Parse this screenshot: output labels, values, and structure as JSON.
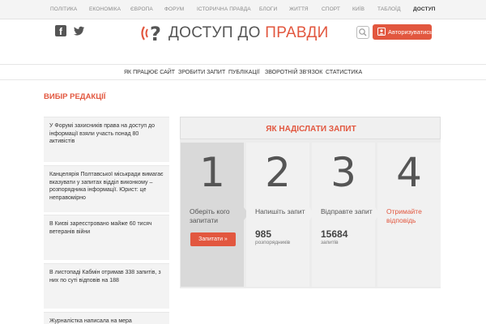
{
  "topnav": {
    "items": [
      "ПОЛІТИКА",
      "ЕКОНОМІКА",
      "ЄВРОПА",
      "ФОРУМ",
      "ІСТОРИЧНА ПРАВДА",
      "БЛОГИ",
      "ЖИТТЯ",
      "СПОРТ",
      "КИЇВ",
      "ТАБЛОЇД",
      "ДОСТУП"
    ],
    "active": "ДОСТУП"
  },
  "header": {
    "logo_text_main": "ДОСТУП ДО ",
    "logo_text_accent": "ПРАВДИ",
    "login_label": "Авторизуватись",
    "icons": [
      "facebook-icon",
      "twitter-icon",
      "search-icon",
      "user-icon"
    ]
  },
  "subnav": {
    "items": [
      "ЯК ПРАЦЮЄ САЙТ",
      "ЗРОБИТИ ЗАПИТ",
      "ПУБЛІКАЦІЇ",
      "ЗВОРОТНІЙ ЗВ'ЯЗОК",
      "СТАТИСТИКА"
    ]
  },
  "editors_choice": {
    "title": "ВИБІР РЕДАКЦІЇ",
    "items": [
      "У Форумі захисників права на доступ до інформації взяли участь понад 80 активістів",
      "Канцелярія Полтавської міськради вимагає вказувати у запитах відділ виконкому – розпорядника інформації. Юрист: це неправомірно",
      "В Києві зареєстровано майже 60 тисяч ветеранів війни",
      "В листопаді Кабмін отримав 338 запитів, з них по суті відповів на 188",
      "Журналістка написала на мера"
    ]
  },
  "howto": {
    "title": "ЯК НАДІСЛАТИ ЗАПИТ",
    "steps": [
      {
        "num": "1",
        "text": "Оберіть кого запитати",
        "button": "Запитати »"
      },
      {
        "num": "2",
        "text": "Напишіть запит",
        "count": "985",
        "count_label": "розпорядників"
      },
      {
        "num": "3",
        "text": "Відправте запит",
        "count": "15684",
        "count_label": "запитів"
      },
      {
        "num": "4",
        "text": "Отримайте відповідь"
      }
    ]
  },
  "colors": {
    "accent": "#e2573f",
    "text": "#333333",
    "muted": "#8a8a8a"
  }
}
